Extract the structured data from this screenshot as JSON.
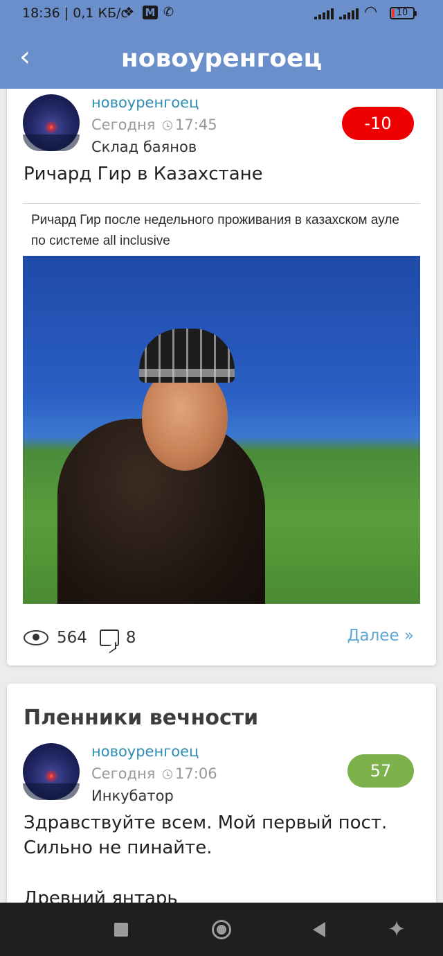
{
  "status_bar": {
    "time": "18:36",
    "speed": "0,1 КБ/с",
    "battery": "10",
    "icons": [
      "dropbox-icon",
      "notification-icon",
      "phone-icon",
      "signal-icon",
      "signal-icon",
      "wifi-icon",
      "battery-icon"
    ]
  },
  "header": {
    "title": "новоуренгоец",
    "back_icon": "‹"
  },
  "posts": [
    {
      "author": "новоуренгоец",
      "date": "Сегодня",
      "time": "17:45",
      "community": "Склад баянов",
      "rating": "-10",
      "rating_color": "#ee0000",
      "title": "Ричард Гир в Казахстане",
      "image_caption": "Ричард Гир после недельного проживания в казахском ауле по системе all inclusive",
      "views": "564",
      "comments": "8",
      "more_label": "Далее »"
    },
    {
      "heading": "Пленники вечности",
      "author": "новоуренгоец",
      "date": "Сегодня",
      "time": "17:06",
      "community": "Инкубатор",
      "rating": "57",
      "rating_color": "#7db14b",
      "text_line1": "Здравствуйте всем. Мой первый пост.",
      "text_line2": "Сильно не пинайте.",
      "text_line3": "Древний янтарь"
    }
  ],
  "accessibility_icon": "✦"
}
